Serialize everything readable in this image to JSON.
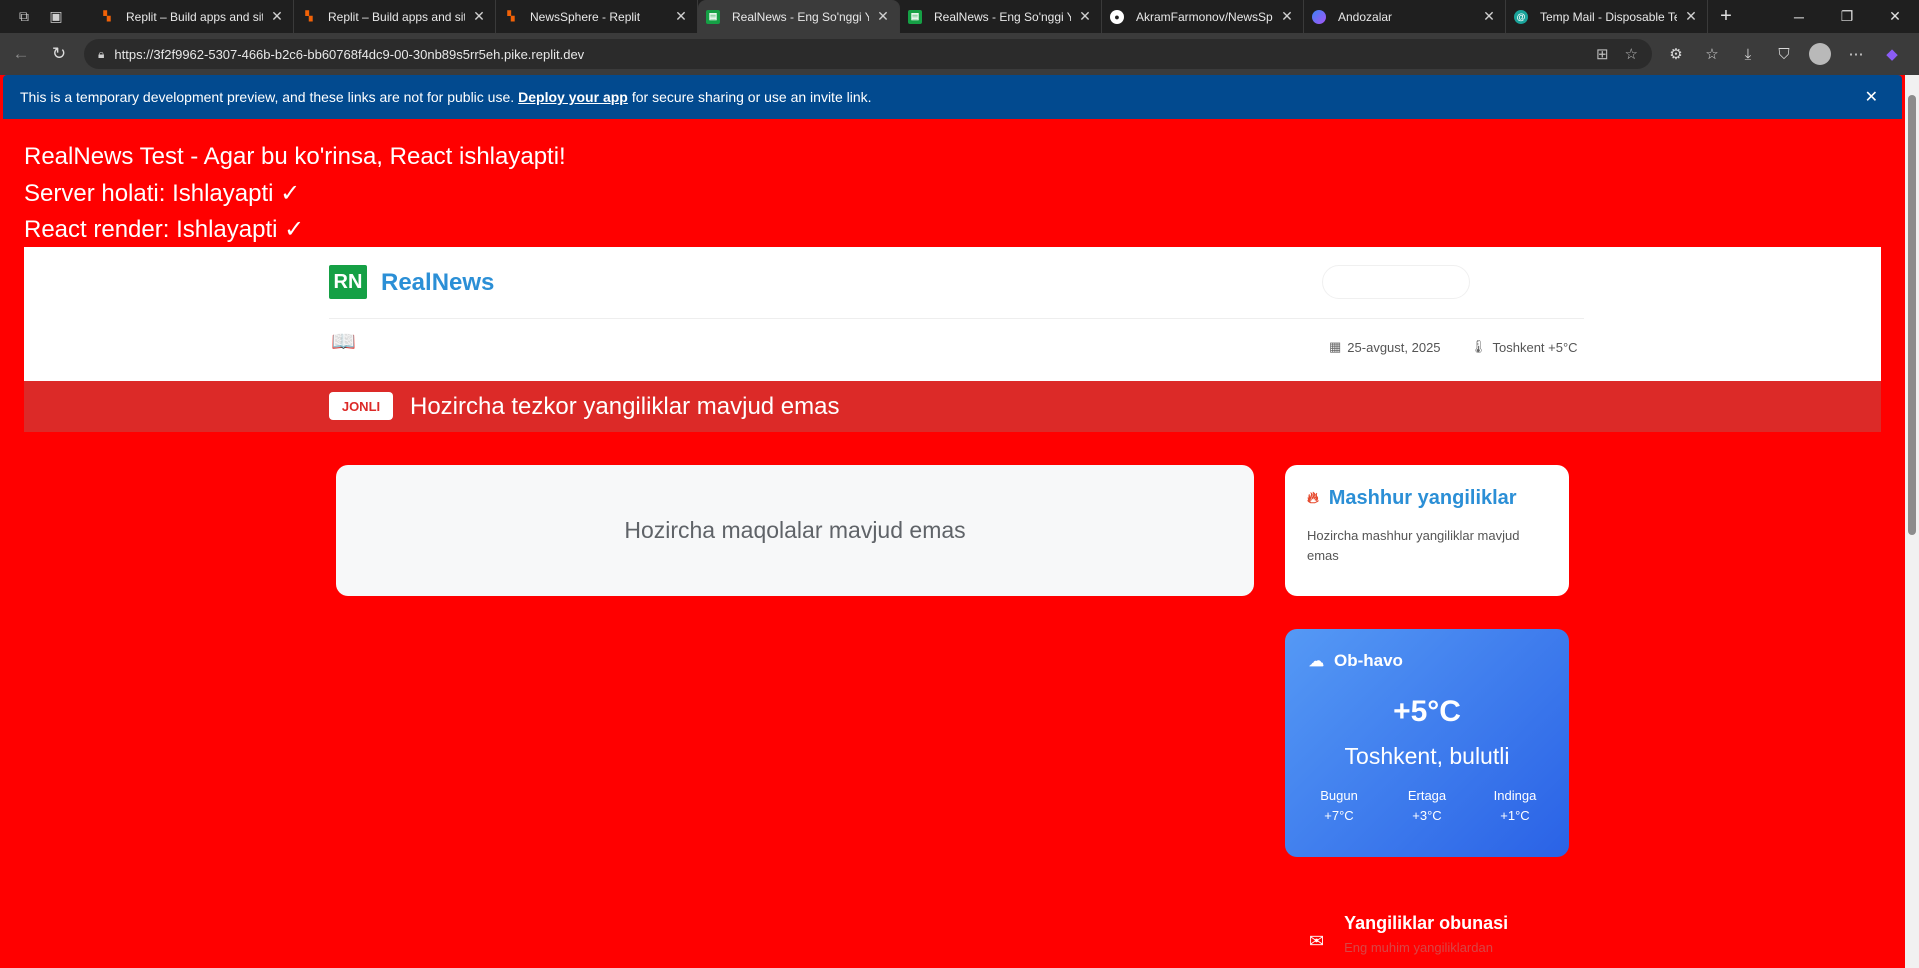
{
  "browser": {
    "tabs": [
      {
        "title": "Replit – Build apps and sites",
        "favicon": "replit-icon",
        "color": "#f26207"
      },
      {
        "title": "Replit – Build apps and sites",
        "favicon": "replit-icon",
        "color": "#f26207"
      },
      {
        "title": "NewsSphere - Replit",
        "favicon": "replit-icon",
        "color": "#f26207"
      },
      {
        "title": "RealNews - Eng So'nggi Yangiliklar",
        "favicon": "realnews-icon",
        "color": "#15a045",
        "active": true
      },
      {
        "title": "RealNews - Eng So'nggi Yangiliklar",
        "favicon": "realnews-icon",
        "color": "#15a045"
      },
      {
        "title": "AkramFarmonov/NewsSphere",
        "favicon": "github-icon",
        "color": "#ffffff"
      },
      {
        "title": "Andozalar",
        "favicon": "copilot-icon",
        "color": "#3b82f6"
      },
      {
        "title": "Temp Mail - Disposable Temporary Email",
        "favicon": "tempmail-icon",
        "color": "#1aa39a"
      }
    ],
    "url": "https://3f2f9962-5307-466b-b2c6-bb60768f4dc9-00-30nb89s5rr5eh.pike.replit.dev"
  },
  "banner": {
    "text_before": "This is a temporary development preview, and these links are not for public use.",
    "link": "Deploy your app",
    "text_after": "for secure sharing or use an invite link."
  },
  "debug": {
    "line1": "RealNews Test - Agar bu ko'rinsa, React ishlayapti!",
    "line2": "Server holati: Ishlayapti ✓",
    "line3": "React render: Ishlayapti ✓"
  },
  "header": {
    "logo_mark": "RN",
    "logo_text": "RealNews",
    "date": "25-avgust, 2025",
    "weather_short": "Toshkent +5°C"
  },
  "breaking": {
    "badge": "JONLI",
    "text": "Hozircha tezkor yangiliklar mavjud emas"
  },
  "articles": {
    "empty": "Hozircha maqolalar mavjud emas"
  },
  "popular": {
    "title": "Mashhur yangiliklar",
    "empty": "Hozircha mashhur yangiliklar mavjud emas"
  },
  "weather": {
    "title": "Ob-havo",
    "temp": "+5°C",
    "desc": "Toshkent, bulutli",
    "forecast": [
      {
        "day": "Bugun",
        "temp": "+7°C"
      },
      {
        "day": "Ertaga",
        "temp": "+3°C"
      },
      {
        "day": "Indinga",
        "temp": "+1°C"
      }
    ]
  },
  "subscribe": {
    "title": "Yangiliklar obunasi",
    "desc": "Eng muhim yangiliklardan"
  },
  "colors": {
    "page_bg": "#ff0000",
    "brand_blue": "#2b8fd6",
    "breaking_red": "#dc2a28",
    "banner_blue": "#024a8f"
  }
}
